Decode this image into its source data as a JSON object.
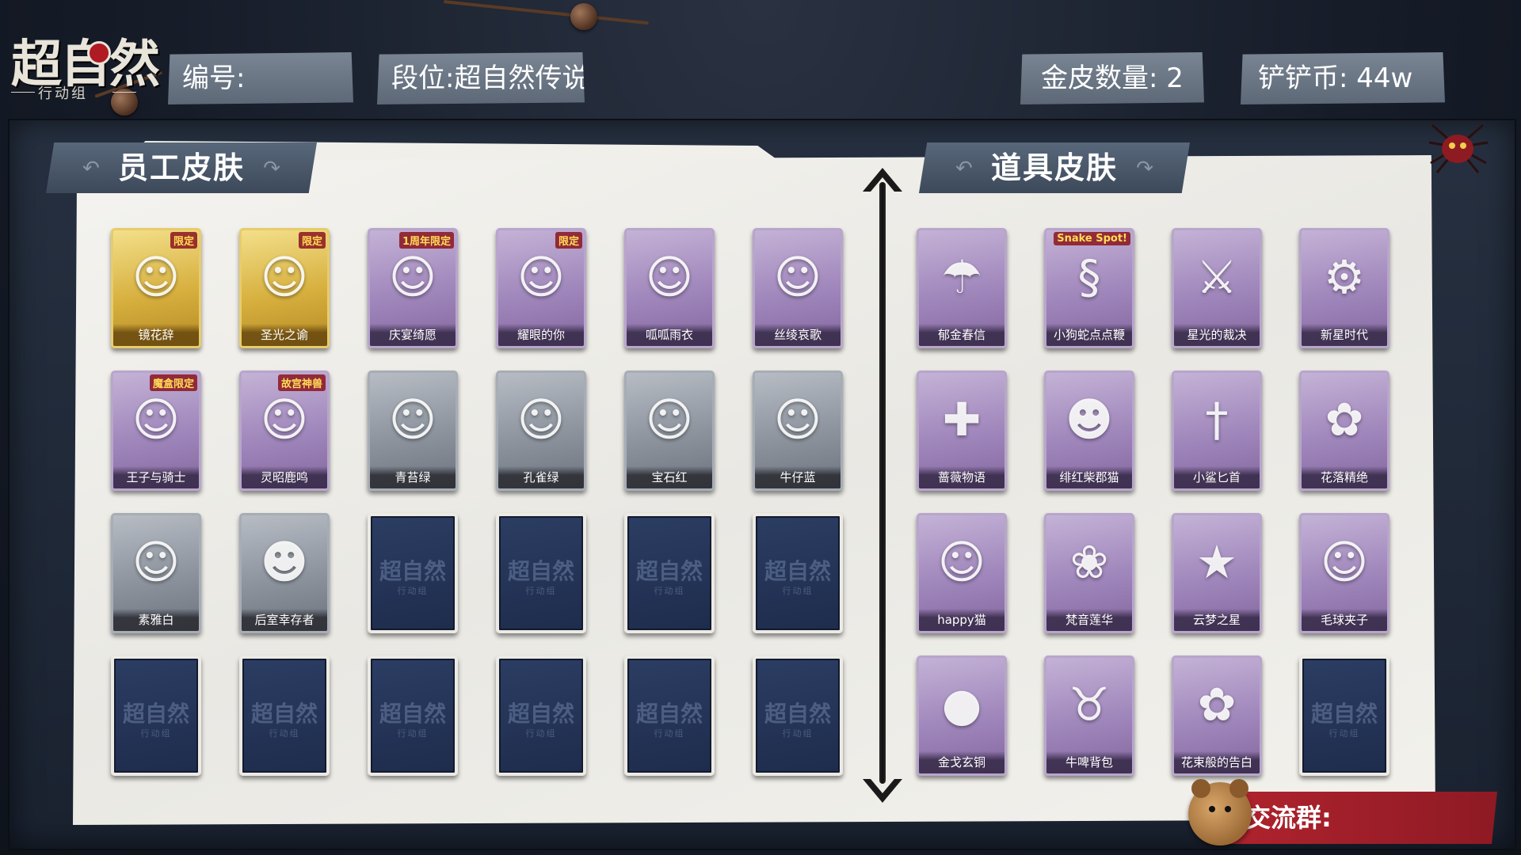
{
  "logo": {
    "main": "超自然",
    "sub": "行动组"
  },
  "header": {
    "id_label": "编号:",
    "rank_label": "段位:超自然传说",
    "gold_skins_label": "金皮数量: 2",
    "coins_label": "铲铲币: 44w"
  },
  "sections": {
    "employee_title": "员工皮肤",
    "item_title": "道具皮肤"
  },
  "employee_skins": [
    {
      "name": "镜花辞",
      "rarity": "gold",
      "tag": "限定",
      "icon": "hooded-girl-icon"
    },
    {
      "name": "圣光之谕",
      "rarity": "gold",
      "tag": "限定",
      "icon": "blonde-girl-icon"
    },
    {
      "name": "庆宴绮愿",
      "rarity": "purple",
      "tag": "1周年限定",
      "icon": "cake-girl-icon"
    },
    {
      "name": "耀眼的你",
      "rarity": "purple",
      "tag": "限定",
      "icon": "cowboy-girl-icon"
    },
    {
      "name": "呱呱雨衣",
      "rarity": "purple",
      "tag": "",
      "icon": "frog-girl-icon"
    },
    {
      "name": "丝绫哀歌",
      "rarity": "purple",
      "tag": "",
      "icon": "gothic-girl-icon"
    },
    {
      "name": "王子与骑士",
      "rarity": "purple",
      "tag": "魔盒限定",
      "icon": "prince-girl-icon"
    },
    {
      "name": "灵昭鹿鸣",
      "rarity": "purple",
      "tag": "故宫神兽",
      "icon": "deer-girl-icon"
    },
    {
      "name": "青苔绿",
      "rarity": "grey",
      "tag": "",
      "icon": "girl-icon"
    },
    {
      "name": "孔雀绿",
      "rarity": "grey",
      "tag": "",
      "icon": "girl-icon"
    },
    {
      "name": "宝石红",
      "rarity": "grey",
      "tag": "",
      "icon": "girl-icon"
    },
    {
      "name": "牛仔蓝",
      "rarity": "grey",
      "tag": "",
      "icon": "girl-icon"
    },
    {
      "name": "素雅白",
      "rarity": "grey",
      "tag": "",
      "icon": "girl-icon"
    },
    {
      "name": "后室幸存者",
      "rarity": "grey",
      "tag": "",
      "icon": "gasmask-icon"
    }
  ],
  "empty_slot": {
    "watermark": "超自然",
    "watermark_sub": "行动组",
    "count_employee": 10,
    "count_item": 1
  },
  "item_skins": [
    {
      "name": "郁金春信",
      "rarity": "purple",
      "tag": "",
      "icon": "parasol-icon"
    },
    {
      "name": "小狗蛇点点鞭",
      "rarity": "purple",
      "tag": "Snake Spot!",
      "icon": "snake-icon"
    },
    {
      "name": "星光的裁决",
      "rarity": "purple",
      "tag": "",
      "icon": "shotgun-icon"
    },
    {
      "name": "新星时代",
      "rarity": "purple",
      "tag": "",
      "icon": "revolver-icon"
    },
    {
      "name": "蔷薇物语",
      "rarity": "purple",
      "tag": "",
      "icon": "medkit-icon"
    },
    {
      "name": "绯红柴郡猫",
      "rarity": "purple",
      "tag": "",
      "icon": "cheshire-cat-icon"
    },
    {
      "name": "小鲨匕首",
      "rarity": "purple",
      "tag": "",
      "icon": "shark-dagger-icon"
    },
    {
      "name": "花落精绝",
      "rarity": "purple",
      "tag": "",
      "icon": "flower-pendant-icon"
    },
    {
      "name": "happy猫",
      "rarity": "purple",
      "tag": "",
      "icon": "happy-cat-icon"
    },
    {
      "name": "梵音莲华",
      "rarity": "purple",
      "tag": "",
      "icon": "lotus-girl-icon"
    },
    {
      "name": "云梦之星",
      "rarity": "purple",
      "tag": "",
      "icon": "unicorn-icon"
    },
    {
      "name": "毛球夹子",
      "rarity": "purple",
      "tag": "",
      "icon": "fox-icon"
    },
    {
      "name": "金戈玄铜",
      "rarity": "purple",
      "tag": "",
      "icon": "grenade-icon"
    },
    {
      "name": "牛啤背包",
      "rarity": "purple",
      "tag": "",
      "icon": "cow-barrel-icon"
    },
    {
      "name": "花束般的告白",
      "rarity": "purple",
      "tag": "",
      "icon": "rose-icon"
    }
  ],
  "group": {
    "label": "交流群:"
  },
  "colors": {
    "gold": "#d7b03f",
    "purple": "#9f86bb",
    "grey": "#8c939d",
    "empty": "#1e2c4c",
    "accent_red": "#b0232e"
  }
}
